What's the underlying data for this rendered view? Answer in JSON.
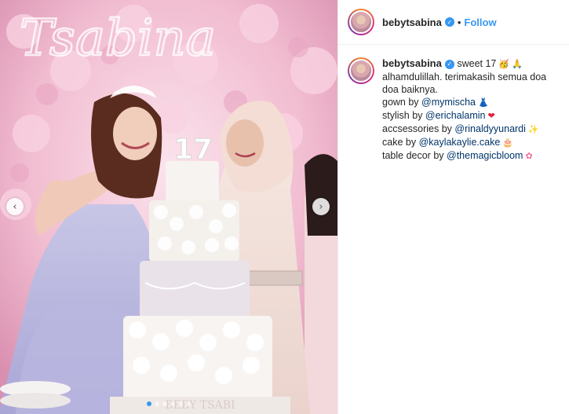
{
  "post": {
    "username": "bebytsabina",
    "follow_label": "Follow",
    "separator": "•"
  },
  "photo": {
    "sign_text": "Tsabina",
    "cake_number": "17",
    "cake_base_text": "BEBY TSABI",
    "carousel_count": 6,
    "carousel_active": 0
  },
  "caption": {
    "username": "bebytsabina",
    "text_1": "sweet 17",
    "line_2": "alhamdulillah. terimakasih semua doa",
    "line_3": "doa baiknya.",
    "gown_prefix": "gown by ",
    "gown_mention": "@mymischa",
    "stylish_prefix": "stylish by ",
    "stylish_mention": "@erichalamin",
    "acc_prefix": "accsessories by ",
    "acc_mention": "@rinaldyyunardi",
    "cake_prefix": "cake by ",
    "cake_mention": "@kaylakaylie.cake",
    "decor_prefix": "table decor by ",
    "decor_mention": "@themagicbloom"
  },
  "icons": {
    "verified": "verified-badge-icon",
    "prev": "chevron-left-icon",
    "next": "chevron-right-icon"
  },
  "colors": {
    "accent": "#3897f0",
    "mention": "#003569",
    "text": "#262626"
  }
}
